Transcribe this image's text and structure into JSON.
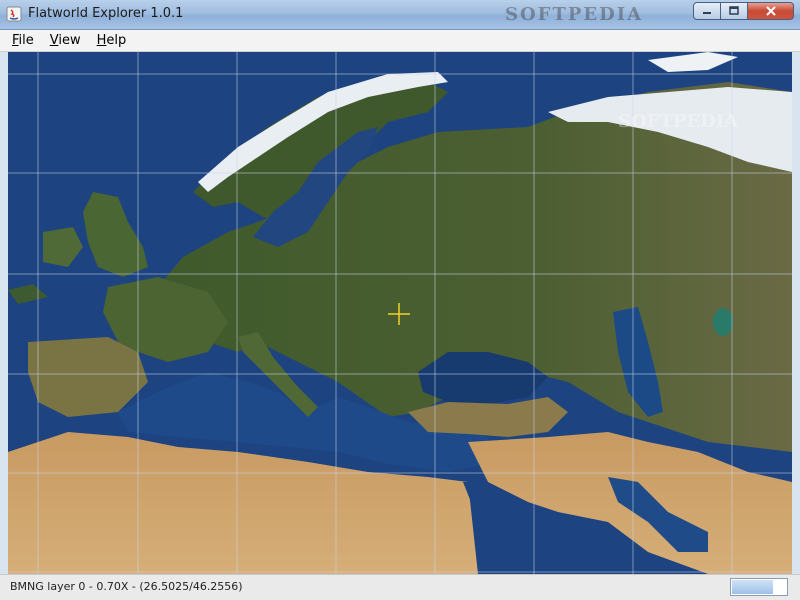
{
  "window": {
    "title": "Flatworld Explorer 1.0.1",
    "watermark": "SOFTPEDIA",
    "controls": {
      "minimize": "minimize-icon",
      "maximize": "maximize-icon",
      "close": "close-icon"
    }
  },
  "menu": [
    {
      "label": "File",
      "mnemonic": "F",
      "rest": "ile"
    },
    {
      "label": "View",
      "mnemonic": "V",
      "rest": "iew"
    },
    {
      "label": "Help",
      "mnemonic": "H",
      "rest": "elp"
    }
  ],
  "map": {
    "grid_color": "#c8d6ea",
    "crosshair_color": "#f2d22b",
    "ocean_color": "#1b3f7a",
    "land_colors": {
      "forest": "#3d5a2a",
      "steppe": "#5c6a3a",
      "desert": "#c9a06a",
      "ice": "#eef2f5"
    },
    "map_watermark": "SOFTPEDIA"
  },
  "status": {
    "text": "BMNG layer 0 - 0.70X - (26.5025/46.2556)",
    "progress_fraction": 0.75
  }
}
